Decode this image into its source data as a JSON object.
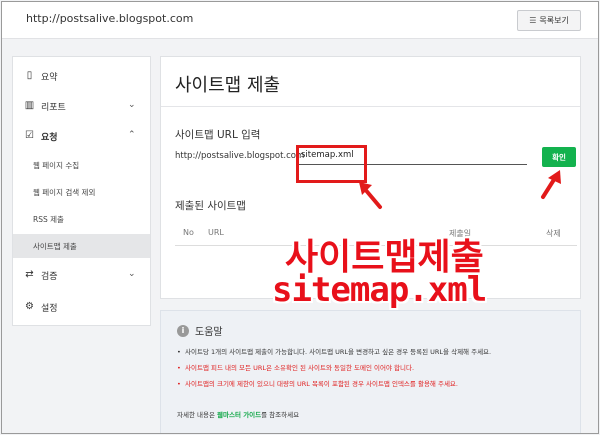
{
  "topbar": {
    "site_url": "http://postsalive.blogspot.com",
    "list_button": "목록보기",
    "list_icon": "list-icon"
  },
  "sidebar": {
    "items": [
      {
        "label": "요약",
        "icon": "document-icon"
      },
      {
        "label": "리포트",
        "icon": "bar-chart-icon"
      },
      {
        "label": "요청",
        "icon": "checkbox-icon"
      },
      {
        "label": "검증",
        "icon": "swap-icon"
      },
      {
        "label": "설정",
        "icon": "gear-icon"
      }
    ],
    "subitems": [
      {
        "label": "웹 페이지 수집"
      },
      {
        "label": "웹 페이지 검색 제외"
      },
      {
        "label": "RSS 제출"
      },
      {
        "label": "사이트맵 제출"
      }
    ]
  },
  "main": {
    "title": "사이트맵 제출",
    "section_title": "사이트맵 URL 입력",
    "base_url": "http://postsalive.blogspot.com",
    "input_value": "sitemap.xml",
    "confirm_button": "확인",
    "submitted_title": "제출된 사이트맵",
    "columns": [
      "No",
      "URL",
      "제출일",
      "삭제"
    ]
  },
  "help": {
    "title": "도움말",
    "items": [
      {
        "text": "사이트당 1개의 사이트맵 제출이 가능합니다. 사이트맵 URL을 변경하고 싶은 경우 등록된 URL을 삭제해 주세요.",
        "warn": false
      },
      {
        "text": "사이트맵 피드 내의 모든 URL은 소유확인 된 사이트와 동일한 도메인 이어야 합니다.",
        "warn": true
      },
      {
        "text": "사이트맵의 크기에 제한이 있으니 대량의 URL 목록이 포함된 경우 사이트맵 인덱스를 활용해 주세요.",
        "warn": true
      }
    ],
    "footer_prefix": "자세한 내용은 ",
    "footer_link": "웹마스터 가이드",
    "footer_suffix": "를 참조하세요"
  },
  "overlay": {
    "line1": "사이트맵제출",
    "line2": "sitemap.xml",
    "color": "#e8101a"
  }
}
